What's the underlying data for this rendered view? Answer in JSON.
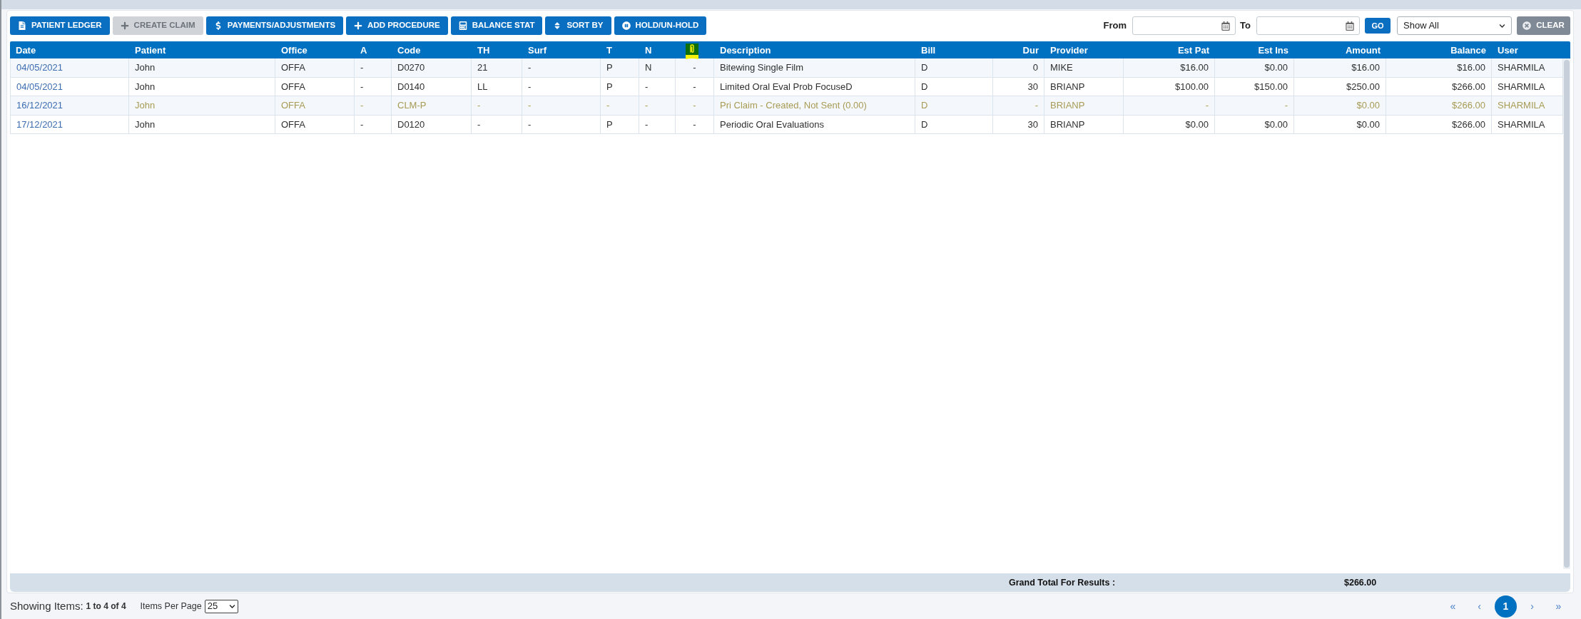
{
  "toolbar": {
    "buttons": [
      {
        "label": "PATIENT LEDGER",
        "disabled": false
      },
      {
        "label": "CREATE CLAIM",
        "disabled": true
      },
      {
        "label": "PAYMENTS/ADJUSTMENTS",
        "disabled": false
      },
      {
        "label": "ADD PROCEDURE",
        "disabled": false
      },
      {
        "label": "BALANCE STAT",
        "disabled": false
      },
      {
        "label": "SORT BY",
        "disabled": false
      },
      {
        "label": "HOLD/UN-HOLD",
        "disabled": false
      }
    ]
  },
  "filters": {
    "from_label": "From",
    "to_label": "To",
    "go_button": "GO",
    "view_select": "Show All",
    "clear_button": "CLEAR"
  },
  "table": {
    "columns": [
      {
        "kind": "text",
        "label": "Date"
      },
      {
        "kind": "text",
        "label": "Patient"
      },
      {
        "kind": "text",
        "label": "Office"
      },
      {
        "kind": "text",
        "label": "A"
      },
      {
        "kind": "text",
        "label": "Code"
      },
      {
        "kind": "text",
        "label": "TH"
      },
      {
        "kind": "text",
        "label": "Surf"
      },
      {
        "kind": "text",
        "label": "T"
      },
      {
        "kind": "text",
        "label": "N"
      },
      {
        "kind": "icon"
      },
      {
        "kind": "text",
        "label": "Description"
      },
      {
        "kind": "text",
        "label": "Bill"
      },
      {
        "kind": "text",
        "label": "Dur"
      },
      {
        "kind": "text",
        "label": "Provider"
      },
      {
        "kind": "text",
        "label": "Est Pat"
      },
      {
        "kind": "text",
        "label": "Est Ins"
      },
      {
        "kind": "text",
        "label": "Amount"
      },
      {
        "kind": "text",
        "label": "Balance"
      },
      {
        "kind": "text",
        "label": "User"
      }
    ],
    "rows": [
      {
        "kind": "procedure",
        "cells": [
          "04/05/2021",
          "John",
          "OFFA",
          "-",
          "D0270",
          "21",
          "-",
          "P",
          "N",
          "-",
          "Bitewing Single Film",
          "D",
          "0",
          "MIKE",
          "$16.00",
          "$0.00",
          "$16.00",
          "$16.00",
          "SHARMILA"
        ]
      },
      {
        "kind": "procedure",
        "cells": [
          "04/05/2021",
          "John",
          "OFFA",
          "-",
          "D0140",
          "LL",
          "-",
          "P",
          "-",
          "-",
          "Limited Oral Eval Prob FocuseD",
          "D",
          "30",
          "BRIANP",
          "$100.00",
          "$150.00",
          "$250.00",
          "$266.00",
          "SHARMILA"
        ]
      },
      {
        "kind": "claim",
        "cells": [
          "16/12/2021",
          "John",
          "OFFA",
          "-",
          "CLM-P",
          "-",
          "-",
          "-",
          "-",
          "-",
          "Pri Claim - Created, Not Sent (0.00)",
          "D",
          "-",
          "BRIANP",
          "-",
          "-",
          "$0.00",
          "$266.00",
          "SHARMILA"
        ]
      },
      {
        "kind": "procedure",
        "cells": [
          "17/12/2021",
          "John",
          "OFFA",
          "-",
          "D0120",
          "-",
          "-",
          "P",
          "-",
          "-",
          "Periodic Oral Evaluations",
          "D",
          "30",
          "BRIANP",
          "$0.00",
          "$0.00",
          "$0.00",
          "$266.00",
          "SHARMILA"
        ]
      }
    ]
  },
  "grand_total": {
    "label": "Grand Total For Results :",
    "amount": "$266.00"
  },
  "footer": {
    "showing_label": "Showing Items:",
    "showing_range": "1 to 4 of 4",
    "per_page_label": "Items Per Page",
    "per_page": "25",
    "pages": [
      {
        "label": "«",
        "selected": false
      },
      {
        "label": "‹",
        "selected": false
      },
      {
        "label": "1",
        "selected": true
      },
      {
        "label": "›",
        "selected": false
      },
      {
        "label": "»",
        "selected": false
      }
    ]
  }
}
